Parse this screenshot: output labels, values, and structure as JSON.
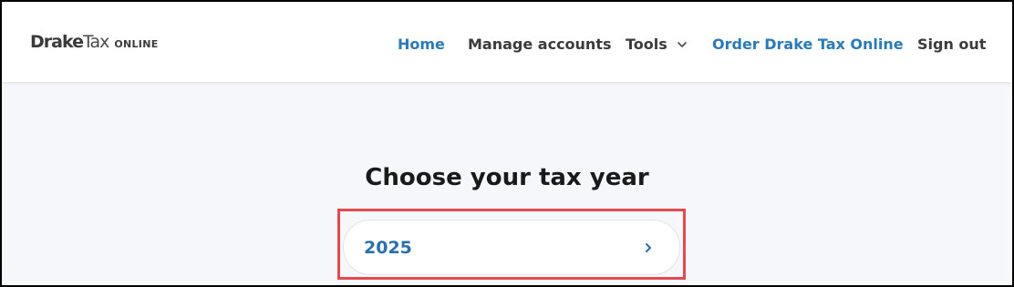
{
  "header": {
    "logo": {
      "drake": "Drake",
      "tax": "Tax",
      "online": "ONLINE"
    },
    "nav": {
      "home": "Home",
      "manage_accounts": "Manage accounts",
      "tools": "Tools",
      "order": "Order Drake Tax Online",
      "sign_out": "Sign out"
    },
    "active_item": "Home"
  },
  "main": {
    "title": "Choose your tax year",
    "years": [
      {
        "label": "2025",
        "icon": "chevron-right-icon"
      }
    ]
  },
  "colors": {
    "link_blue": "#2a7ab8",
    "nav_text": "#3b3b3b",
    "page_bg": "#f6f7fb",
    "highlight_red": "#e5484d"
  },
  "icons": {
    "tools_dropdown": "chevron-down-icon",
    "year_arrow": "chevron-right-icon"
  }
}
